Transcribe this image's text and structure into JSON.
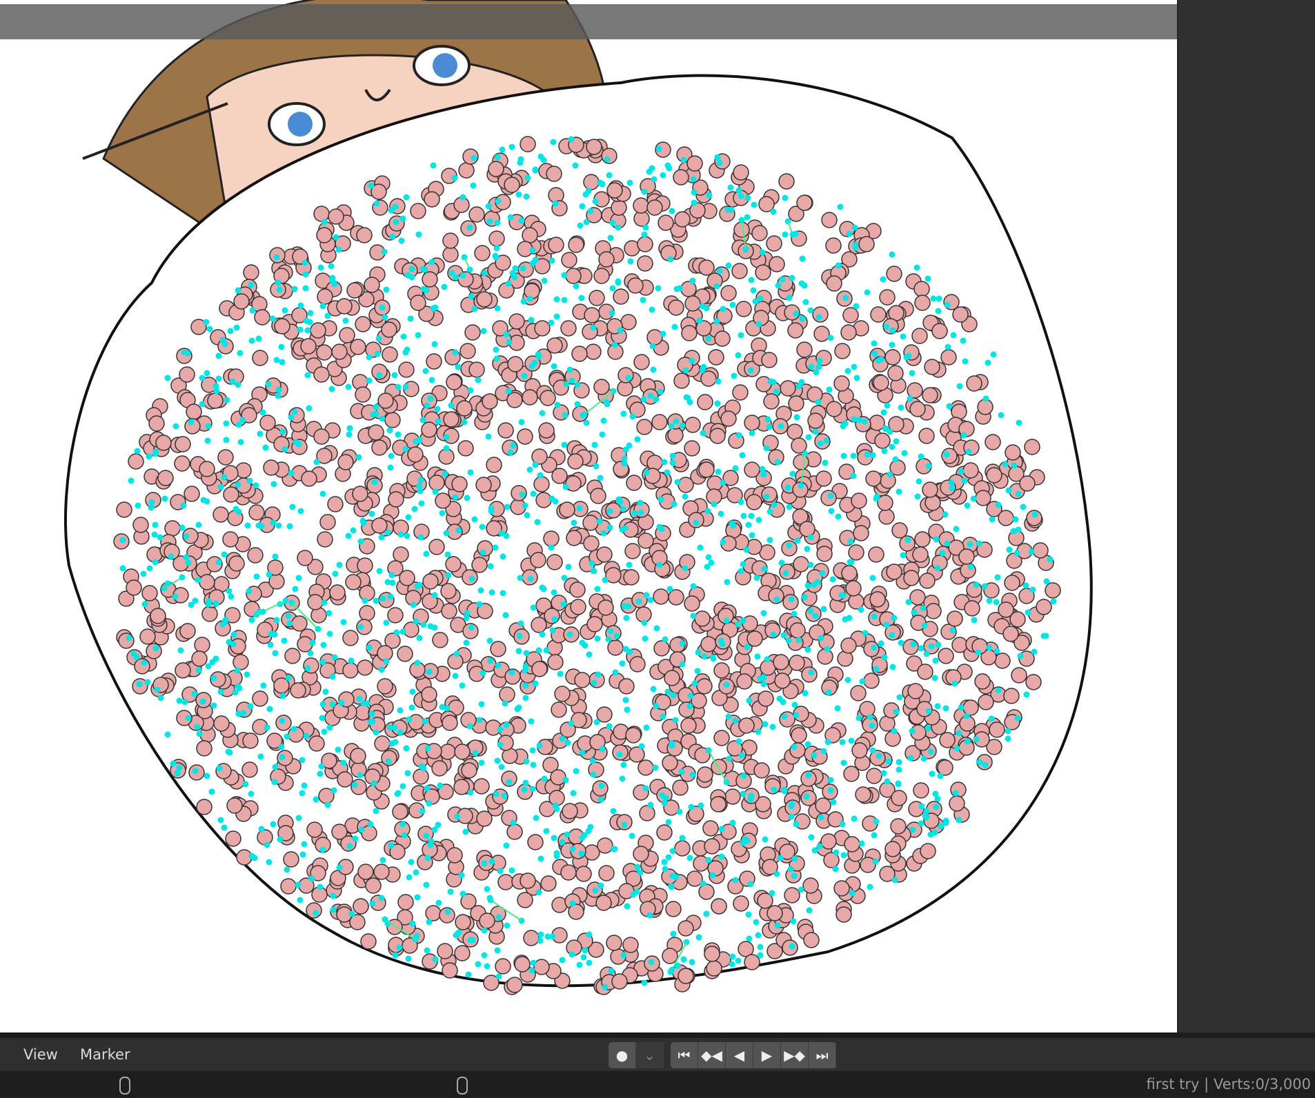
{
  "timeline": {
    "menu_view": "View",
    "menu_marker": "Marker",
    "record_icon": "●",
    "dropdown_icon": "⌄",
    "playback": [
      "⏮",
      "◆◀",
      "◀",
      "▶",
      "▶◆",
      "⏭"
    ]
  },
  "status": {
    "text": "first try | Verts:0/3,000"
  },
  "colors": {
    "blob": "#e8a8a8",
    "points": "#00e5e5",
    "lines": "#44ee88",
    "hair": "#9c7448"
  }
}
